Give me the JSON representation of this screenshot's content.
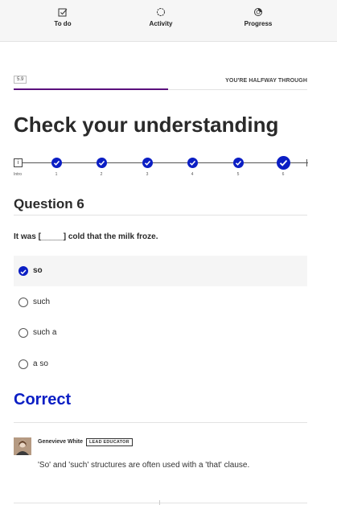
{
  "nav": {
    "items": [
      {
        "label": "To do",
        "icon": "checkbox-icon"
      },
      {
        "label": "Activity",
        "icon": "circle-icon"
      },
      {
        "label": "Progress",
        "icon": "progress-icon"
      }
    ]
  },
  "step": {
    "number": "5.9",
    "progress_fraction": 0.5,
    "status": "YOU'RE HALFWAY THROUGH"
  },
  "page_title": "Check your understanding",
  "stepper": {
    "intro_label": "Intro",
    "intro_glyph": "i",
    "steps": [
      "1",
      "2",
      "3",
      "4",
      "5",
      "6"
    ],
    "current": "6"
  },
  "question": {
    "heading": "Question 6",
    "text": "It was [_____] cold that the milk froze.",
    "options": [
      {
        "label": "so",
        "selected": true
      },
      {
        "label": "such",
        "selected": false
      },
      {
        "label": "such a",
        "selected": false
      },
      {
        "label": "a so",
        "selected": false
      }
    ]
  },
  "result": {
    "label": "Correct",
    "color": "#0b1ec4"
  },
  "comment": {
    "author": "Genevieve White",
    "badge": "LEAD EDUCATOR",
    "text": "'So' and 'such' structures are often used with a 'that' clause."
  },
  "colors": {
    "accent": "#0b1ec4",
    "progress": "#5a0f7c"
  }
}
